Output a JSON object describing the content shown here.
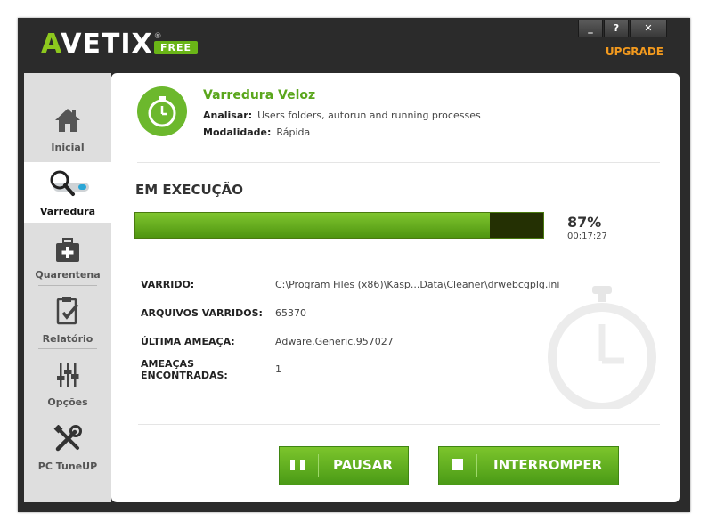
{
  "app": {
    "logo_text": "VETIX",
    "logo_letter": "A",
    "registered": "®",
    "edition_badge": "FREE",
    "upgrade_label": "UPGRADE"
  },
  "window_controls": {
    "minimize": "_",
    "help": "?",
    "close": "✕"
  },
  "sidebar": {
    "items": [
      {
        "label": "Inicial",
        "icon": "home-icon",
        "active": false
      },
      {
        "label": "Varredura",
        "icon": "magnifier-icon",
        "active": true
      },
      {
        "label": "Quarentena",
        "icon": "medkit-icon",
        "active": false
      },
      {
        "label": "Relatório",
        "icon": "clipboard-icon",
        "active": false
      },
      {
        "label": "Opções",
        "icon": "sliders-icon",
        "active": false
      },
      {
        "label": "PC TuneUP",
        "icon": "tools-icon",
        "active": false
      }
    ]
  },
  "scan": {
    "title": "Varredura Veloz",
    "analyze_label": "Analisar:",
    "analyze_value": "Users folders, autorun and running processes",
    "mode_label": "Modalidade:",
    "mode_value": "Rápida"
  },
  "status": {
    "heading": "EM EXECUÇÃO",
    "progress": 0.87,
    "percent_text": "87%",
    "elapsed": "00:17:27"
  },
  "details": [
    {
      "key": "VARRIDO:",
      "value": "C:\\Program Files (x86)\\Kasp...Data\\Cleaner\\drwebcgplg.ini"
    },
    {
      "key": "ARQUIVOS VARRIDOS:",
      "value": "65370"
    },
    {
      "key": "ÚLTIMA AMEAÇA:",
      "value": "Adware.Generic.957027"
    },
    {
      "key": "AMEAÇAS ENCONTRADAS:",
      "value": "1"
    }
  ],
  "buttons": {
    "pause": "PAUSAR",
    "stop": "INTERROMPER"
  },
  "colors": {
    "accent": "#6ab517",
    "upgrade": "#f39a1e",
    "chrome": "#2b2b2b"
  }
}
